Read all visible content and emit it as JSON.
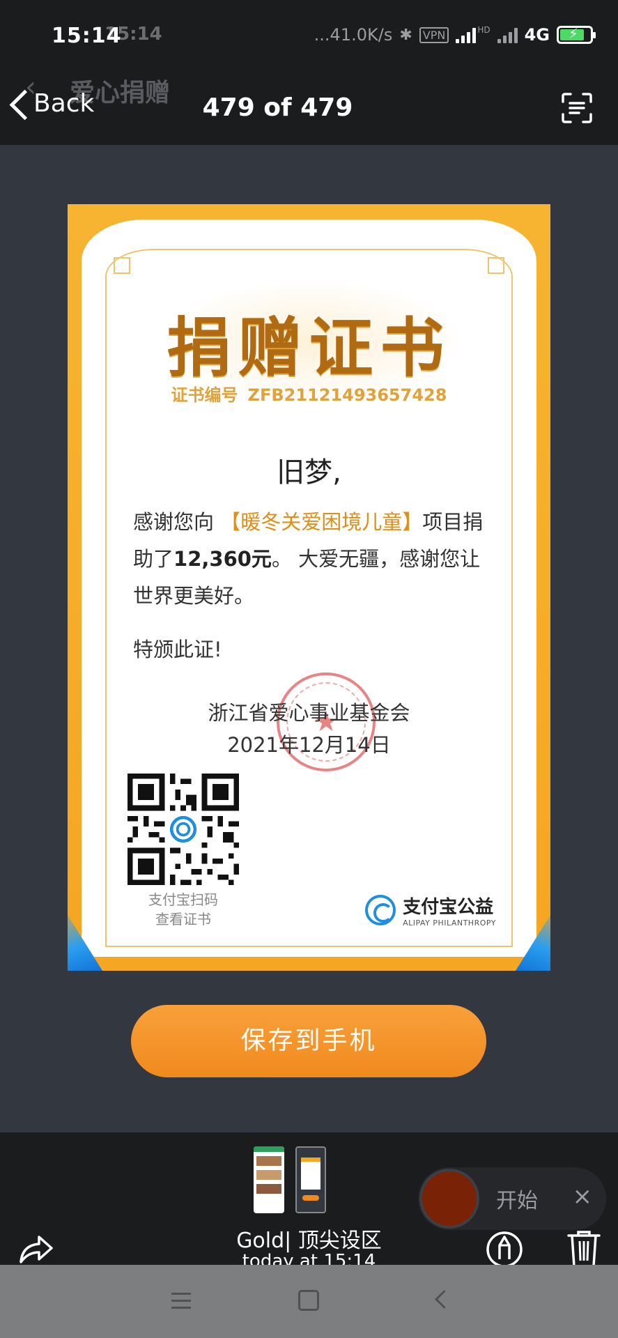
{
  "status": {
    "time": "15:14",
    "ghost_time": "15:14",
    "net_speed": "...41.0K/s",
    "vpn": "VPN",
    "hd": "HD",
    "network": "4G"
  },
  "nav": {
    "back_label": "Back",
    "counter": "479 of 479",
    "ghost_title": "爱心捐赠"
  },
  "certificate": {
    "title": "捐赠证书",
    "number_label": "证书编号",
    "number": "ZFB21121493657428",
    "recipient": "旧梦,",
    "body_pre": "感谢您向 ",
    "project": "【暖冬关爱困境儿童】",
    "body_mid": "项目捐助了",
    "amount": "12,360元",
    "body_post": "。 大爱无疆，感谢您让世界更美好。",
    "closing": "特颁此证!",
    "org": "浙江省爱心事业基金会",
    "date": "2021年12月14日",
    "qr_caption_1": "支付宝扫码",
    "qr_caption_2": "查看证书",
    "brand_cn": "支付宝公益",
    "brand_en": "ALIPAY PHILANTHROPY"
  },
  "save_button": "保存到手机",
  "toolbar": {
    "album_title": "Gold| 顶尖设区",
    "album_subtitle": "today at 15:14"
  },
  "recorder": {
    "start_label": "开始",
    "close_label": "×"
  },
  "colors": {
    "accent_orange": "#f08a1e",
    "certificate_gold": "#f5a623",
    "title_brown": "#b06a12",
    "brand_blue": "#1e8fe0",
    "seal_red": "#e25b5b"
  }
}
